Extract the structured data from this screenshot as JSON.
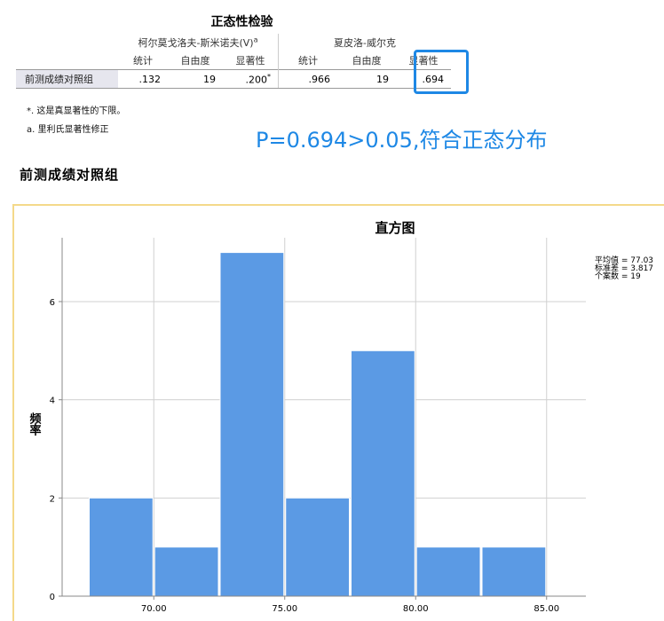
{
  "table": {
    "title": "正态性检验",
    "group1": "柯尔莫戈洛夫-斯米诺夫(V)",
    "group1_sup": "a",
    "group2": "夏皮洛-威尔克",
    "headers": [
      "统计",
      "自由度",
      "显著性",
      "统计",
      "自由度",
      "显著性"
    ],
    "row": {
      "label": "前测成绩对照组",
      "values": [
        ".132",
        "19",
        ".200",
        ".966",
        "19",
        ".694"
      ],
      "sig_mark": "*"
    },
    "footnote1": "*. 这是真显著性的下限。",
    "footnote2": "a. 里利氏显著性修正"
  },
  "annotation": "P=0.694>0.05,符合正态分布",
  "section_title": "前测成绩对照组",
  "chart_data": {
    "type": "bar",
    "title": "直方图",
    "ylabel": "频率",
    "xlabel": "",
    "bins": [
      {
        "from": 67.5,
        "to": 70.0,
        "count": 2
      },
      {
        "from": 70.0,
        "to": 72.5,
        "count": 1
      },
      {
        "from": 72.5,
        "to": 75.0,
        "count": 7
      },
      {
        "from": 75.0,
        "to": 77.5,
        "count": 2
      },
      {
        "from": 77.5,
        "to": 80.0,
        "count": 5
      },
      {
        "from": 80.0,
        "to": 82.5,
        "count": 1
      },
      {
        "from": 82.5,
        "to": 85.0,
        "count": 1
      }
    ],
    "x_ticks": [
      70,
      75,
      80,
      85
    ],
    "x_tick_labels": [
      "70.00",
      "75.00",
      "80.00",
      "85.00"
    ],
    "y_ticks": [
      0,
      2,
      4,
      6
    ],
    "ylim": [
      0,
      7.3
    ],
    "xlim": [
      66.5,
      86.5
    ],
    "grid": true,
    "bar_color": "#5b9ae4",
    "stats": [
      "平均值 = 77.03",
      "标准差 = 3.817",
      "个案数 = 19"
    ]
  }
}
